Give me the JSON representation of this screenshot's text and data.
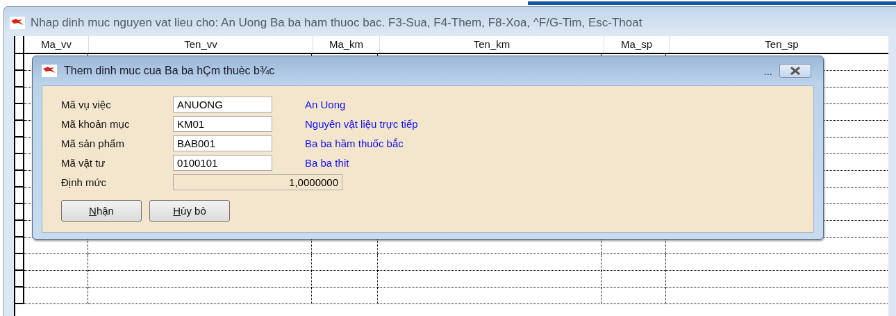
{
  "window": {
    "title": "Nhap dinh muc nguyen vat lieu cho: An Uong Ba ba ham thuoc bac. F3-Sua, F4-Them, F8-Xoa, ^F/G-Tim, Esc-Thoat"
  },
  "table": {
    "columns": [
      "Ma_vv",
      "Ten_vv",
      "Ma_km",
      "Ten_km",
      "Ma_sp",
      "Ten_sp"
    ]
  },
  "dialog": {
    "title": "Them dinh muc cua Ba ba hÇm thuèc b¾c",
    "more_label": "...",
    "fields": [
      {
        "kind": "text",
        "label": "Mã vụ việc",
        "value": "ANUONG",
        "description": "An Uong"
      },
      {
        "kind": "text",
        "label": "Mã khoản mục",
        "value": "KM01",
        "description": "Nguyên vật liệu trực tiếp"
      },
      {
        "kind": "text",
        "label": "Mã sản phẩm",
        "value": "BAB001",
        "description": "Ba ba hầm thuốc bắc"
      },
      {
        "kind": "text",
        "label": "Mã vật tư",
        "value": "0100101",
        "description": "Ba ba thit"
      },
      {
        "kind": "number",
        "label": "Định mức",
        "value": "1,0000000",
        "disabled": true
      }
    ],
    "buttons": [
      {
        "label": "Nhận"
      },
      {
        "label": "Hủy bỏ"
      }
    ]
  }
}
